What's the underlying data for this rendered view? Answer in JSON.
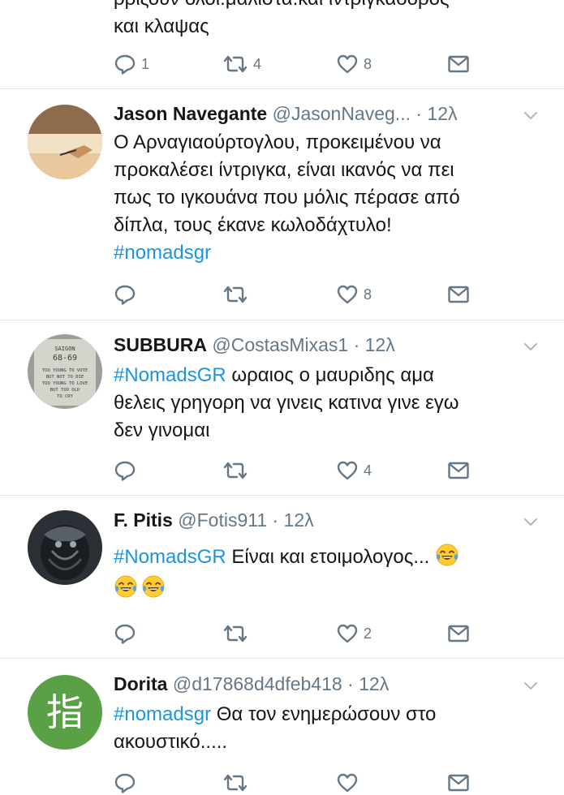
{
  "tweets": [
    {
      "body_lines": [
        "ρριξουν ολοι.μαλιστα.και ιντριγκαδορος",
        "και κλαψας"
      ],
      "actions": {
        "reply": "1",
        "retweet": "4",
        "like": "8"
      }
    },
    {
      "name": "Jason Navegante",
      "handle": "@JasonNaveg...",
      "time": "· 12λ",
      "body_lines": [
        "Ο Αρναγιαούρτογλου, προκειμένου να",
        "προκαλέσει ίντριγκα, είναι ικανός να πει",
        "πως το ιγκουάνα που μόλις πέρασε από",
        "δίπλα, τους έκανε κωλοδάχτυλο!"
      ],
      "hashtag": "#nomadsgr",
      "actions": {
        "reply": "",
        "retweet": "",
        "like": "8"
      }
    },
    {
      "name": "SUBBURA",
      "handle": "@CostasMixas1",
      "time": "· 12λ",
      "hashtag": "#NomadsGR",
      "body_first": " ωραιος ο μαυριδης αμα",
      "body_lines": [
        "θελεις γρηγορη να γινεις κατινα γινε εγω",
        "δεν γινομαι"
      ],
      "avatar_text": [
        "SAIGON",
        "68-69",
        "TOO YOUNG TO VOTE",
        "BUT NOT TO DIE",
        "TOO YOUNG TO LOVE",
        "BUT TOO OLD",
        "TO CRY"
      ],
      "actions": {
        "reply": "",
        "retweet": "",
        "like": "4"
      }
    },
    {
      "name": "F. Pitis",
      "handle": "@Fotis911",
      "time": "· 12λ",
      "hashtag": "#NomadsGR",
      "body_first": " Είναι και ετοιμολογος...",
      "actions": {
        "reply": "",
        "retweet": "",
        "like": "2"
      }
    },
    {
      "name": "Dorita",
      "handle": "@d17868d4dfeb418",
      "time": "· 12λ",
      "hashtag": "#nomadsgr",
      "body_first": " Θα τον ενημερώσουν στο",
      "body_lines": [
        "ακουστικό....."
      ],
      "avatar_text": "指"
    }
  ],
  "colors": {
    "accent": "#1b95e0",
    "text": "#14171a",
    "muted": "#657786",
    "divider": "#e1e8ed"
  }
}
